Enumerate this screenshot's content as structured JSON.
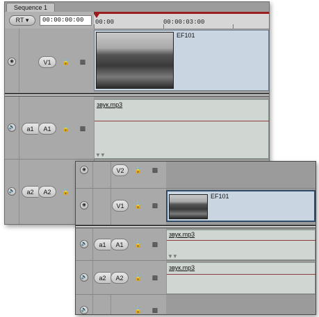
{
  "sequence_tab": "Sequence 1",
  "toolbar": {
    "rt_button": "RT",
    "timecode": "00:00:00:00"
  },
  "ruler": {
    "start": "00:00",
    "mid": "00:00:03:00",
    "end": "00:00"
  },
  "tracks_back": {
    "v1": {
      "dest_label": "V1",
      "clip_name": "EF101"
    },
    "a1": {
      "source_label": "a1",
      "dest_label": "A1",
      "clip_name": "звук.mp3"
    },
    "a2": {
      "source_label": "a2",
      "dest_label": "A2"
    }
  },
  "tracks_front": {
    "v2": {
      "dest_label": "V2"
    },
    "v1": {
      "dest_label": "V1",
      "clip_name": "EF101"
    },
    "a1": {
      "source_label": "a1",
      "dest_label": "A1",
      "clip_name": "звук.mp3"
    },
    "a2": {
      "source_label": "a2",
      "dest_label": "A2",
      "clip_name": "звук.mp3"
    }
  },
  "icons": {
    "track_visibility": "circle-icon",
    "audio": "speaker-icon",
    "lock": "lock-icon",
    "link": "film-icon"
  }
}
